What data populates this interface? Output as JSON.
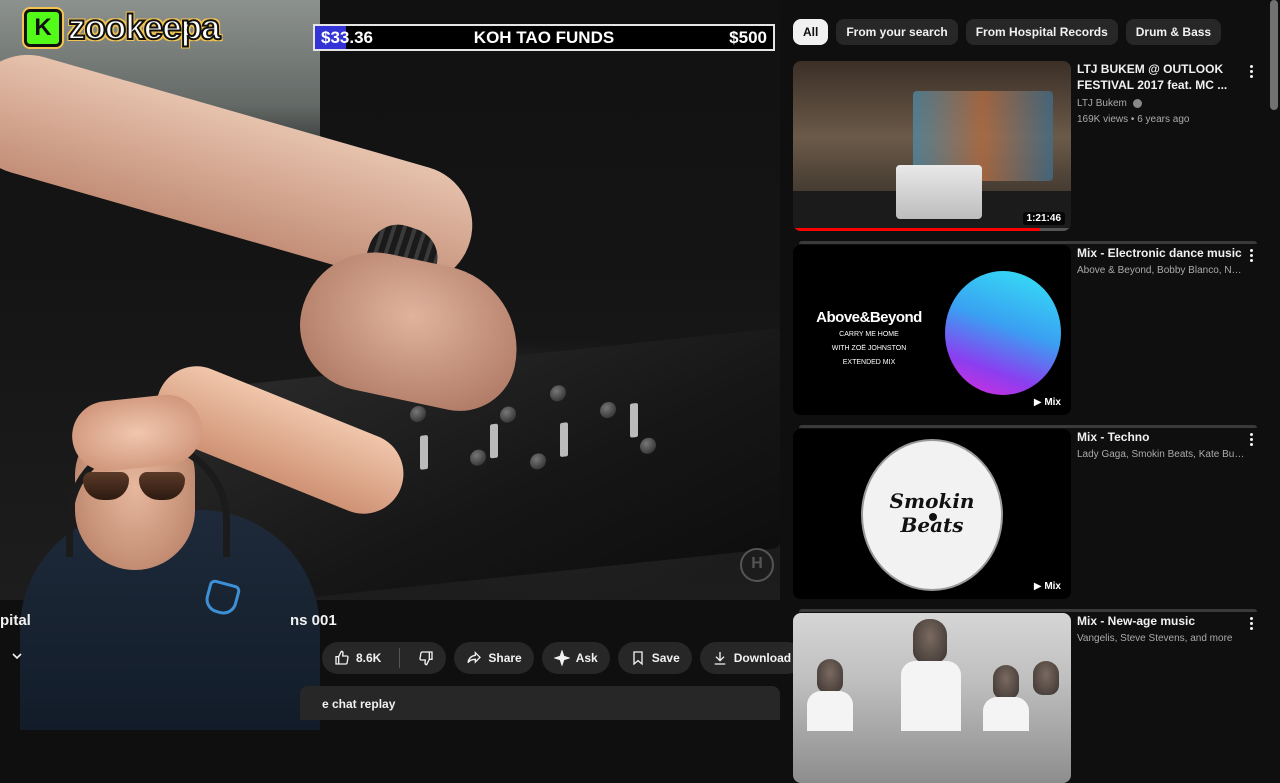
{
  "overlay": {
    "logo_text": "zookeepa",
    "logo_k": "K",
    "funds": {
      "current": "$33.36",
      "title": "KOH TAO FUNDS",
      "goal": "$500",
      "progress_fraction": 0.067,
      "fill_color": "#3333d6"
    },
    "watermark": "H"
  },
  "video": {
    "title_left": "pital",
    "title_right": "ns 001",
    "actions": {
      "like_count": "8.6K",
      "share_label": "Share",
      "ask_label": "Ask",
      "save_label": "Save",
      "download_label": "Download"
    },
    "chat_replay_label": "e chat replay"
  },
  "filters": {
    "chips": [
      "All",
      "From your search",
      "From Hospital Records",
      "Drum & Bass"
    ],
    "active": "All"
  },
  "recommendations": [
    {
      "title": "LTJ BUKEM @ OUTLOOK FESTIVAL 2017 feat. MC ...",
      "channel": "LTJ Bukem",
      "verified_icon": "verified-icon",
      "meta": "169K views • 6 years ago",
      "duration": "1:21:46",
      "watched_fraction": 0.89
    },
    {
      "title": "Mix - Electronic dance music",
      "meta": "Above & Beyond, Bobby Blanco, Nomad, a...",
      "badge": "Mix",
      "thumb_brand": "Above&Beyond",
      "thumb_lines": [
        "CARRY ME HOME",
        "WITH ZOË JOHNSTON",
        "EXTENDED MIX"
      ]
    },
    {
      "title": "Mix - Techno",
      "meta": "Lady Gaga, Smokin Beats, Kate Bush, and ...",
      "badge": "Mix",
      "thumb_brand": "Smokin Beats"
    },
    {
      "title": "Mix - New-age music",
      "meta": "Vangelis, Steve Stevens, and more"
    }
  ]
}
